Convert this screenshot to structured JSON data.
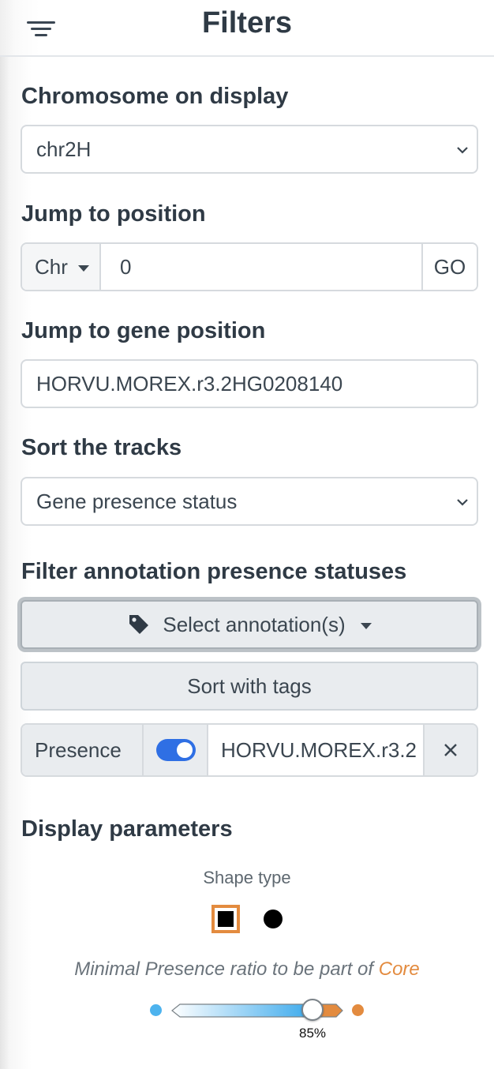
{
  "header": {
    "title": "Filters",
    "menu_icon": "filter-lines-icon"
  },
  "chromosome": {
    "label": "Chromosome on display",
    "selected": "chr2H"
  },
  "jump_position": {
    "label": "Jump to position",
    "chr_dropdown_label": "Chr",
    "value": "0",
    "go_label": "GO"
  },
  "jump_gene": {
    "label": "Jump to gene position",
    "value": "HORVU.MOREX.r3.2HG0208140"
  },
  "sort_tracks": {
    "label": "Sort the tracks",
    "selected": "Gene presence status"
  },
  "annotation_filter": {
    "label": "Filter annotation presence statuses",
    "select_button_label": "Select annotation(s)",
    "tag_icon": "tag-icon",
    "sort_tags_label": "Sort with tags",
    "presence_label": "Presence",
    "presence_toggle_on": true,
    "presence_value": "HORVU.MOREX.r3.2",
    "remove_icon": "close-icon"
  },
  "display_parameters": {
    "label": "Display parameters",
    "shape_type_label": "Shape type",
    "shapes": [
      "square",
      "circle"
    ],
    "selected_shape": "square",
    "core_text_prefix": "Minimal Presence ratio to be part of ",
    "core_text_highlight": "Core",
    "slider_value": "85%",
    "slider_fraction": 0.85
  },
  "colors": {
    "accent_orange": "#e38b3f",
    "toggle_blue": "#2f6fe4",
    "slider_blue": "#4db3ee",
    "text_dark": "#2f3a45"
  }
}
